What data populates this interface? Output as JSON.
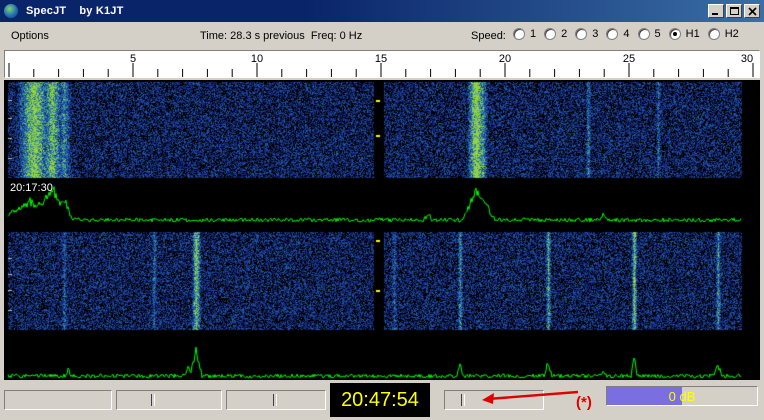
{
  "window": {
    "title": "SpecJT    by K1JT",
    "icon": "globe-icon"
  },
  "menu": {
    "options_label": "Options"
  },
  "status": {
    "time_text": "Time: 28.3 s previous  Freq: 0 Hz"
  },
  "speed": {
    "label": "Speed:",
    "options": [
      "1",
      "2",
      "3",
      "4",
      "5",
      "H1",
      "H2"
    ],
    "selected": "H1"
  },
  "scale": {
    "labels": [
      "5",
      "10",
      "15",
      "20",
      "25",
      "30"
    ],
    "max": 30
  },
  "waterfall": {
    "timestamp": "20:17:30"
  },
  "footer": {
    "clock": "20:47:54",
    "level_text": "0 dB",
    "level_fraction": 0.5,
    "annotation": "(*)"
  },
  "colors": {
    "trace": "#00ff00",
    "clock_text": "#ffff00",
    "annotation": "#e00000",
    "titlebar": "#0a246a"
  }
}
